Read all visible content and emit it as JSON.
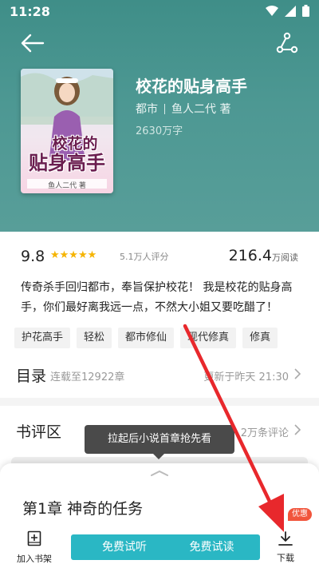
{
  "status": {
    "time": "11:28"
  },
  "book": {
    "cover_title_line1": "校花的",
    "cover_title_line2": "贴身高手",
    "cover_author": "鱼人二代 著",
    "title": "校花的贴身高手",
    "category": "都市",
    "author": "鱼人二代 著",
    "word_count": "2630万字"
  },
  "stats": {
    "score": "9.8",
    "stars": "★★★★★",
    "raters": "5.1万人评分",
    "reads_value": "216.4",
    "reads_unit": "万阅读"
  },
  "intro": "传奇杀手回归都市，奉旨保护校花！ 我是校花的贴身高手，你们最好离我远一点，不然大小姐又要吃醋了！",
  "tags": [
    "护花高手",
    "轻松",
    "都市修仙",
    "现代修真",
    "修真"
  ],
  "toc": {
    "title": "目录",
    "subtitle": "连载至12922章",
    "update": "更新于昨天 21:30"
  },
  "reviews": {
    "title": "书评区",
    "count": "2万条评论"
  },
  "tooltip": "拉起后小说首章抢先看",
  "sheet": {
    "chapter": "第1章 神奇的任务",
    "shelf_label": "加入书架",
    "listen_label": "免费试听",
    "read_label": "免费试读",
    "download_label": "下载",
    "badge": "优惠"
  },
  "colors": {
    "teal_header": "#4d9893",
    "button": "#2ab7c4",
    "star": "#f5b400",
    "badge": "#f1553c",
    "annotation_arrow": "#e8282c"
  }
}
